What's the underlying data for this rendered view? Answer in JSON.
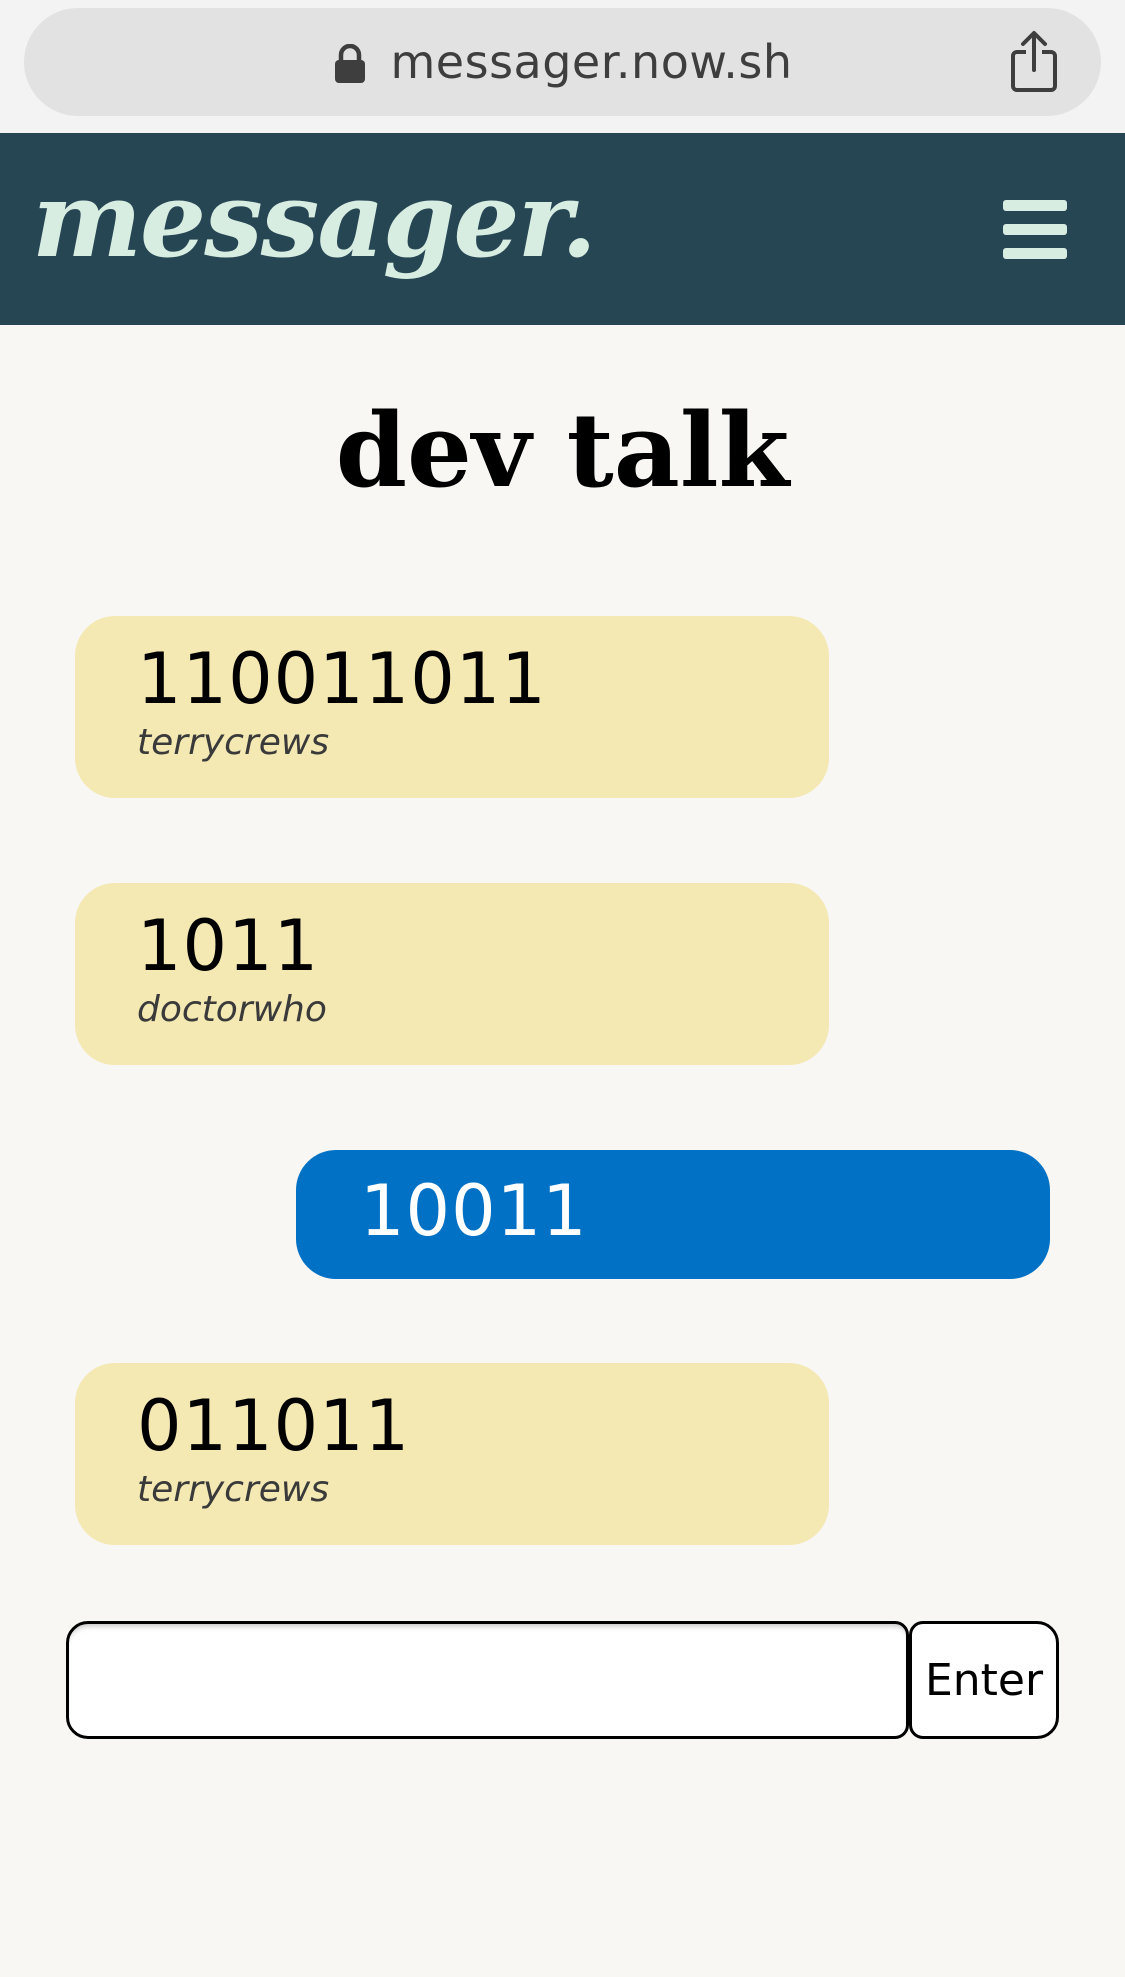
{
  "browser": {
    "url": "messager.now.sh",
    "lock_icon": "lock-icon",
    "share_icon": "share-icon"
  },
  "header": {
    "logo": "messager.",
    "menu_icon": "hamburger-menu-icon",
    "colors": {
      "background": "#274654",
      "logo": "#d8ede2"
    }
  },
  "room": {
    "title": "dev talk"
  },
  "messages": [
    {
      "text": "110011011",
      "user": "terrycrews",
      "sent_by_me": false
    },
    {
      "text": "1011",
      "user": "doctorwho",
      "sent_by_me": false
    },
    {
      "text": "10011",
      "user": "",
      "sent_by_me": true
    },
    {
      "text": "011011",
      "user": "terrycrews",
      "sent_by_me": false
    }
  ],
  "composer": {
    "value": "",
    "placeholder": "",
    "enter_label": "Enter"
  },
  "colors": {
    "page_background": "#f8f7f3",
    "received_bubble": "#f4e8b3",
    "sent_bubble": "#0071c5"
  }
}
